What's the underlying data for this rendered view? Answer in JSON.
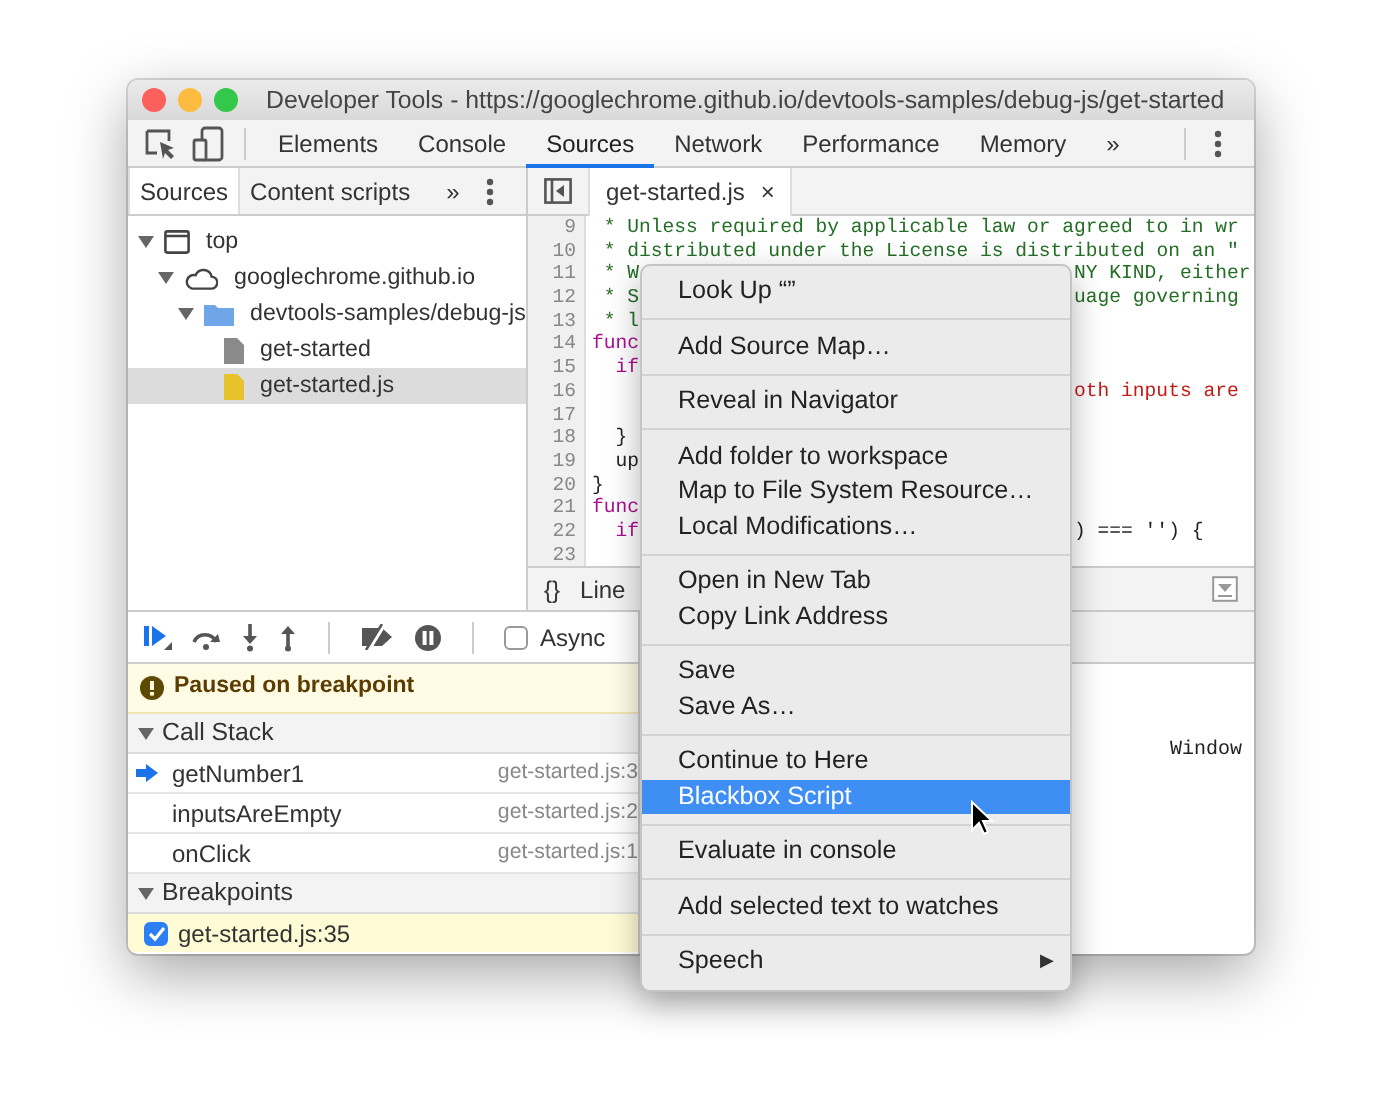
{
  "window": {
    "title": "Developer Tools - https://googlechrome.github.io/devtools-samples/debug-js/get-started"
  },
  "main_tabs": [
    {
      "label": "Elements",
      "selected": false
    },
    {
      "label": "Console",
      "selected": false
    },
    {
      "label": "Sources",
      "selected": true
    },
    {
      "label": "Network",
      "selected": false
    },
    {
      "label": "Performance",
      "selected": false
    },
    {
      "label": "Memory",
      "selected": false
    }
  ],
  "more_tabs": "»",
  "navigator": {
    "tabs": [
      {
        "label": "Sources",
        "selected": true
      },
      {
        "label": "Content scripts",
        "selected": false
      }
    ],
    "more": "»",
    "tree": [
      {
        "label": "top",
        "kind": "frame",
        "expanded": true,
        "selected": false,
        "children": [
          {
            "label": "googlechrome.github.io",
            "kind": "cloud",
            "expanded": true,
            "selected": false,
            "children": [
              {
                "label": "devtools-samples/debug-js",
                "kind": "folder",
                "expanded": true,
                "selected": false,
                "children": [
                  {
                    "label": "get-started",
                    "kind": "document",
                    "selected": false
                  },
                  {
                    "label": "get-started.js",
                    "kind": "script",
                    "selected": true
                  }
                ]
              }
            ]
          }
        ]
      }
    ]
  },
  "editor": {
    "tabs": [
      {
        "label": "get-started.js",
        "close": "×",
        "selected": true
      }
    ],
    "lines": [
      {
        "number": "9",
        "left": {
          "text": " * Unless required by applicable law or agreed to in wr",
          "kind": "comment"
        }
      },
      {
        "number": "10",
        "left": {
          "text": " * distributed under the License is distributed on an \"",
          "kind": "comment"
        }
      },
      {
        "number": "11",
        "left": {
          "text": " * W",
          "kind": "comment"
        },
        "right": {
          "text": "NY KIND, either",
          "kind": "comment"
        }
      },
      {
        "number": "12",
        "left": {
          "text": " * S",
          "kind": "comment"
        },
        "right": {
          "text": "uage governing",
          "kind": "comment"
        }
      },
      {
        "number": "13",
        "left": {
          "text": " * l",
          "kind": "comment"
        }
      },
      {
        "number": "14",
        "left": {
          "text": "func",
          "kind": "keyword"
        }
      },
      {
        "number": "15",
        "left": {
          "text": "  if",
          "kind": "keyword"
        }
      },
      {
        "number": "16",
        "right": {
          "text": "oth inputs are",
          "kind": "string"
        }
      },
      {
        "number": "17"
      },
      {
        "number": "18",
        "left": {
          "text": "  }",
          "kind": "plain"
        }
      },
      {
        "number": "19",
        "left": {
          "text": "  up",
          "kind": "plain"
        }
      },
      {
        "number": "20",
        "left": {
          "text": "}",
          "kind": "plain"
        }
      },
      {
        "number": "21",
        "left": {
          "text": "func",
          "kind": "keyword"
        }
      },
      {
        "number": "22",
        "left": {
          "text": "  if",
          "kind": "keyword"
        },
        "right": {
          "text": ") === '') {",
          "kind": "plain"
        }
      },
      {
        "number": "23"
      }
    ],
    "status": {
      "format": "{}",
      "text": "Line"
    }
  },
  "debugger": {
    "async": {
      "label": "Async",
      "checked": false
    },
    "banner": "Paused on breakpoint",
    "call_stack": {
      "title": "Call Stack",
      "expanded": true,
      "frames": [
        {
          "name": "getNumber1",
          "location": "get-started.js:3",
          "selected": true
        },
        {
          "name": "inputsAreEmpty",
          "location": "get-started.js:2",
          "selected": false
        },
        {
          "name": "onClick",
          "location": "get-started.js:1",
          "selected": false
        }
      ]
    },
    "breakpoints": {
      "title": "Breakpoints",
      "expanded": true,
      "items": [
        {
          "label": "get-started.js:35",
          "checked": true
        }
      ]
    }
  },
  "scope": {
    "text": "Window"
  },
  "context_menu": {
    "groups": [
      [
        {
          "label": "Look Up “”",
          "selected": false
        }
      ],
      [
        {
          "label": "Add Source Map…",
          "selected": false
        }
      ],
      [
        {
          "label": "Reveal in Navigator",
          "selected": false
        }
      ],
      [
        {
          "label": "Add folder to workspace",
          "selected": false
        },
        {
          "label": "Map to File System Resource…",
          "selected": false
        },
        {
          "label": "Local Modifications…",
          "selected": false
        }
      ],
      [
        {
          "label": "Open in New Tab",
          "selected": false
        },
        {
          "label": "Copy Link Address",
          "selected": false
        }
      ],
      [
        {
          "label": "Save",
          "selected": false
        },
        {
          "label": "Save As…",
          "selected": false
        }
      ],
      [
        {
          "label": "Continue to Here",
          "selected": false
        },
        {
          "label": "Blackbox Script",
          "selected": true
        }
      ],
      [
        {
          "label": "Evaluate in console",
          "selected": false
        }
      ],
      [
        {
          "label": "Add selected text to watches",
          "selected": false
        }
      ],
      [
        {
          "label": "Speech",
          "selected": false,
          "arrow": "▶"
        }
      ]
    ]
  }
}
